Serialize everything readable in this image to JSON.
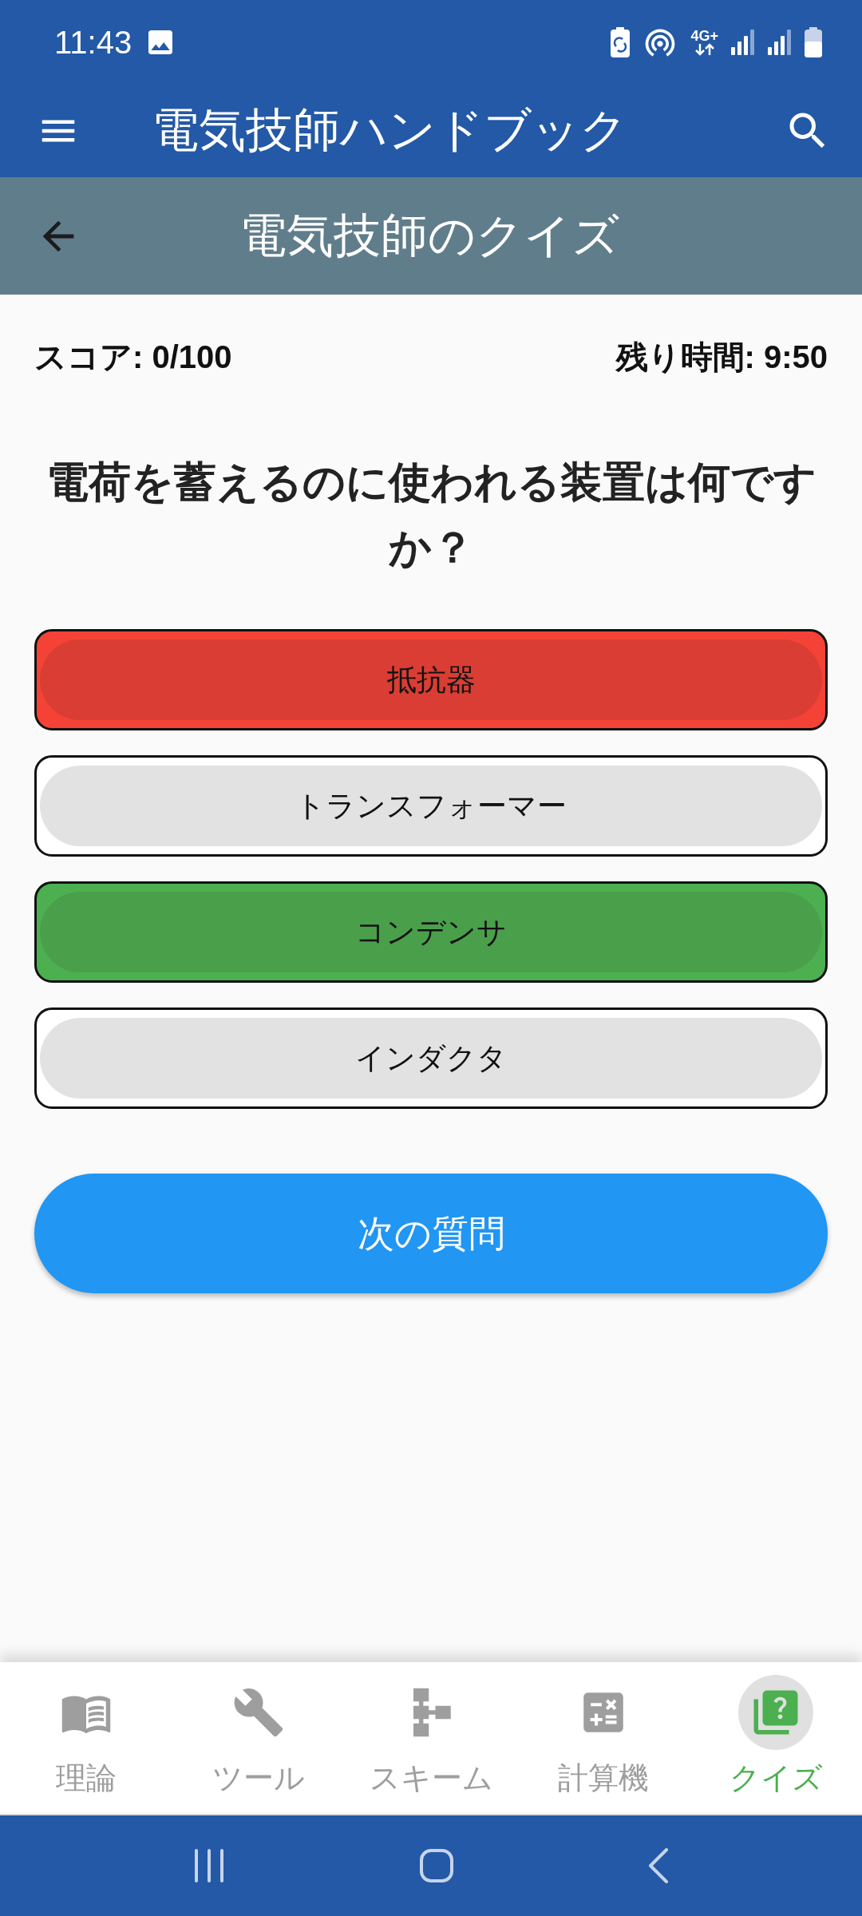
{
  "status_bar": {
    "time": "11:43",
    "network_type": "4G+"
  },
  "app_bar": {
    "title": "電気技師ハンドブック"
  },
  "sub_header": {
    "title": "電気技師のクイズ"
  },
  "quiz": {
    "score": "スコア: 0/100",
    "time_left": "残り時間: 9:50",
    "question": "電荷を蓄えるのに使われる装置は何ですか？",
    "answers": [
      {
        "label": "抵抗器",
        "kind": "wrong"
      },
      {
        "label": "トランスフォーマー",
        "kind": "plain"
      },
      {
        "label": "コンデンサ",
        "kind": "correct"
      },
      {
        "label": "インダクタ",
        "kind": "plain"
      }
    ],
    "next_button": "次の質問"
  },
  "bottom_nav": [
    {
      "label": "理論",
      "selected": false
    },
    {
      "label": "ツール",
      "selected": false
    },
    {
      "label": "スキーム",
      "selected": false
    },
    {
      "label": "計算機",
      "selected": false
    },
    {
      "label": "クイズ",
      "selected": true
    }
  ]
}
